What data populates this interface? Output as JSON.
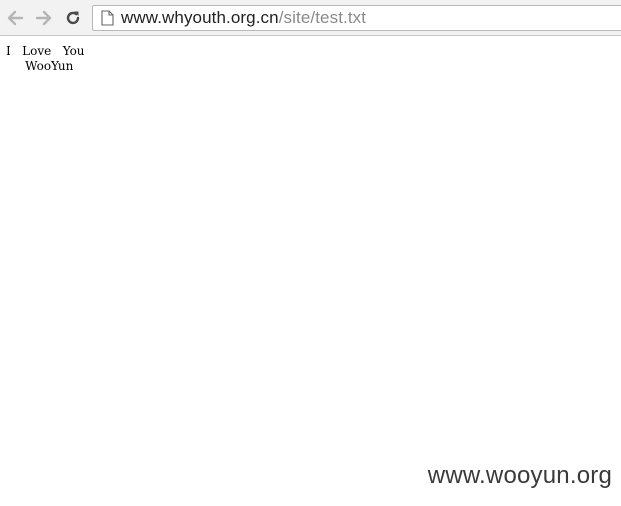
{
  "browser": {
    "toolbar": {
      "back_icon": "arrow-left-icon",
      "forward_icon": "arrow-right-icon",
      "reload_icon": "reload-icon"
    },
    "address_bar": {
      "icon": "page-icon",
      "url_host": "www.whyouth.org.cn",
      "url_path": "/site/test.txt"
    }
  },
  "page": {
    "lines": [
      "I   Love   You",
      "     WooYun"
    ]
  },
  "watermark": "www.wooyun.org",
  "colors": {
    "toolbar_bg": "#f2f2f2",
    "url_host": "#222222",
    "url_path": "#8a8a8a",
    "icon_gray": "#b5b5b5",
    "icon_dark": "#4a4a4a"
  }
}
